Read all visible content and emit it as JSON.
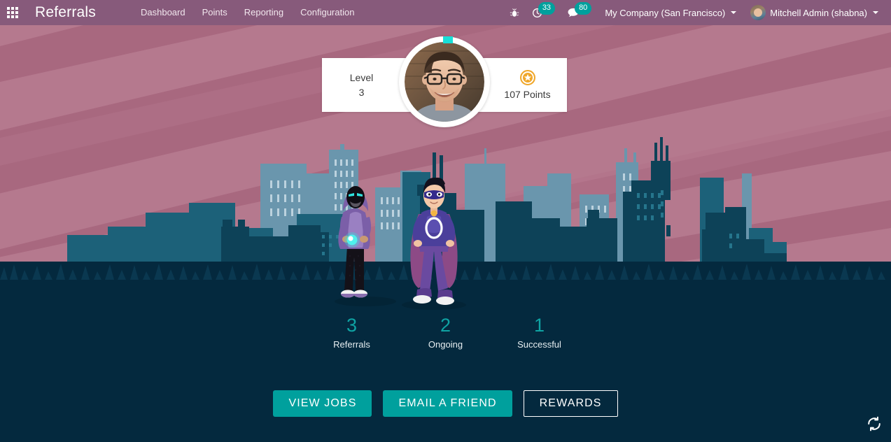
{
  "navbar": {
    "apps_icon": "apps-grid-icon",
    "brand": "Referrals",
    "menu": [
      {
        "label": "Dashboard"
      },
      {
        "label": "Points"
      },
      {
        "label": "Reporting"
      },
      {
        "label": "Configuration"
      }
    ],
    "debug_icon": "bug-icon",
    "activities": {
      "icon": "clock-icon",
      "count": "33"
    },
    "messages": {
      "icon": "chat-bubble-icon",
      "count": "80"
    },
    "company": "My Company (San Francisco)",
    "user": "Mitchell Admin (shabna)"
  },
  "hero": {
    "level_label": "Level",
    "level_value": "3",
    "points_text": "107 Points",
    "star_icon": "star-badge-icon",
    "avatar_alt": "user-avatar"
  },
  "stats": [
    {
      "value": "3",
      "label": "Referrals"
    },
    {
      "value": "2",
      "label": "Ongoing"
    },
    {
      "value": "1",
      "label": "Successful"
    }
  ],
  "actions": [
    {
      "label": "VIEW JOBS",
      "style": "primary"
    },
    {
      "label": "EMAIL A FRIEND",
      "style": "primary"
    },
    {
      "label": "REWARDS",
      "style": "outline"
    }
  ],
  "footer": {
    "refresh_icon": "refresh-icon"
  },
  "colors": {
    "brand_purple": "#875A7B",
    "teal": "#00A09D",
    "stat_teal": "#0FA3A3",
    "sky_pink": "#a8687f",
    "ground_navy": "#04293E",
    "star_gold": "#F0A72B",
    "progress_cyan": "#18E0D8"
  }
}
